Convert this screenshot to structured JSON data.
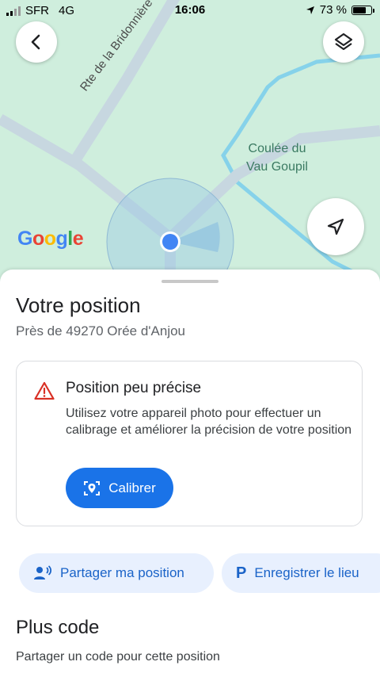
{
  "status_bar": {
    "carrier": "SFR",
    "network": "4G",
    "time": "16:06",
    "battery": "73 %",
    "battery_level": 0.73
  },
  "map": {
    "road_label": "Rte de la Bridonnière",
    "place_label_line1": "Coulée du",
    "place_label_line2": "Vau Goupil",
    "logo": "Google",
    "logo_colors": [
      "#4285F4",
      "#EA4335",
      "#FBBC05",
      "#4285F4",
      "#34A853",
      "#EA4335"
    ],
    "buttons": {
      "back": "back-arrow-icon",
      "layers": "layers-icon",
      "location": "navigation-arrow-icon"
    }
  },
  "sheet": {
    "title": "Votre position",
    "subtitle": "Près de 49270 Orée d'Anjou",
    "warning": {
      "icon": "warning-triangle-icon",
      "title": "Position peu précise",
      "body": "Utilisez votre appareil photo pour effectuer un calibrage et améliorer la précision de votre position",
      "button_label": "Calibrer"
    },
    "chips": [
      {
        "label": "Partager ma position",
        "icon": "share-person-icon"
      },
      {
        "label": "Enregistrer le lieu",
        "icon": "parking-icon"
      }
    ],
    "plus_code": {
      "title": "Plus code",
      "subtitle": "Partager un code pour cette position"
    }
  },
  "colors": {
    "accent": "#1a73e8",
    "chip_bg": "#e8f0fe",
    "warning": "#d93025",
    "map_bg": "#cfeedd",
    "water": "#7fd0e8"
  }
}
